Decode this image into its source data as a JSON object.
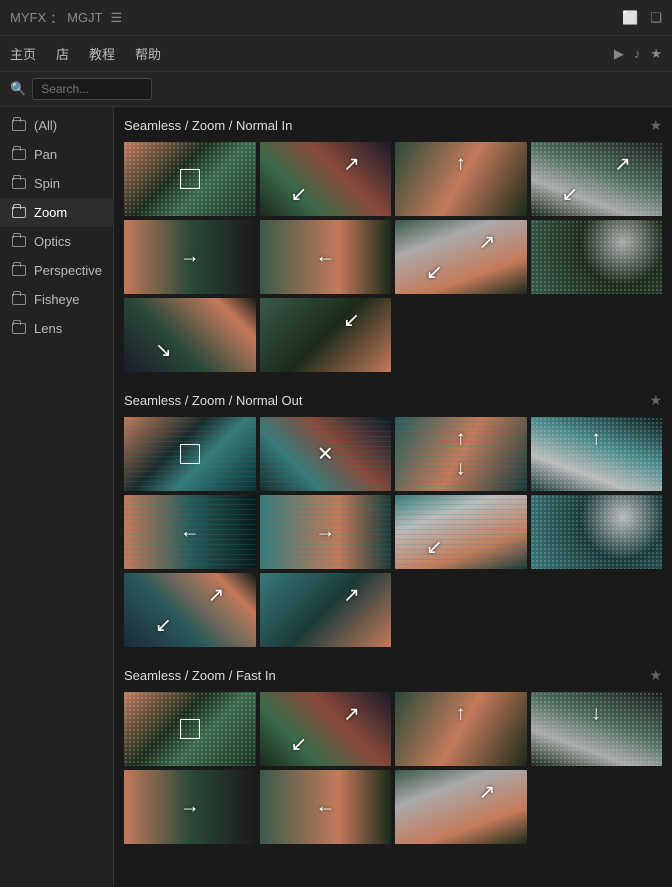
{
  "header": {
    "brand1": "MYFX",
    "separator": "：",
    "brand2": "MGJT",
    "menu_label": "☰"
  },
  "nav": {
    "items": [
      {
        "label": "主页",
        "key": "home"
      },
      {
        "label": "店",
        "key": "shop"
      },
      {
        "label": "教程",
        "key": "tutorial"
      },
      {
        "label": "帮助",
        "key": "help"
      }
    ]
  },
  "search": {
    "placeholder": "Search..."
  },
  "sidebar": {
    "items": [
      {
        "label": "(All)",
        "key": "all"
      },
      {
        "label": "Pan",
        "key": "pan"
      },
      {
        "label": "Spin",
        "key": "spin"
      },
      {
        "label": "Zoom",
        "key": "zoom",
        "active": true
      },
      {
        "label": "Optics",
        "key": "optics"
      },
      {
        "label": "Perspective",
        "key": "perspective"
      },
      {
        "label": "Fisheye",
        "key": "fisheye"
      },
      {
        "label": "Lens",
        "key": "lens"
      }
    ]
  },
  "sections": [
    {
      "title": "Seamless / Zoom / Normal In",
      "key": "normal-in"
    },
    {
      "title": "Seamless / Zoom / Normal Out",
      "key": "normal-out"
    },
    {
      "title": "Seamless / Zoom / Fast In",
      "key": "fast-in"
    }
  ],
  "icons": {
    "star": "★",
    "play": "▶",
    "sound": "♪",
    "window1": "⬜",
    "window2": "❑",
    "arrow_up": "↑",
    "arrow_down": "↓",
    "arrow_left": "←",
    "arrow_right": "→",
    "arrow_expand": "↗",
    "arrow_contract": "↙",
    "arrow_nw": "↖",
    "arrow_se": "↘"
  }
}
